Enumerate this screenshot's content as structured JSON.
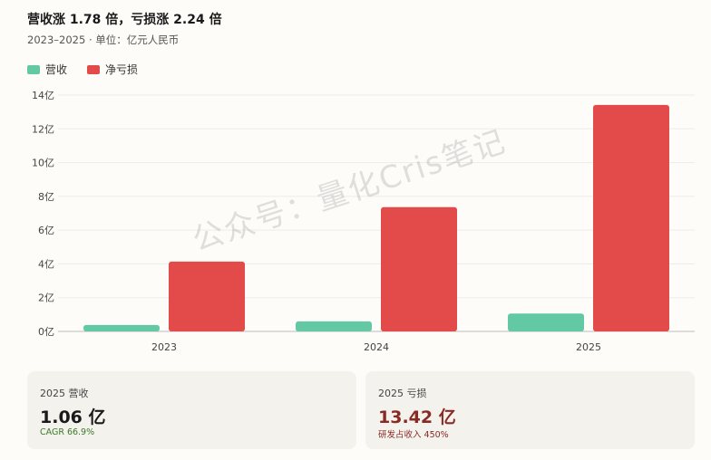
{
  "header": {
    "title": "营收涨 1.78 倍，亏损涨 2.24 倍",
    "subtitle": "2023–2025 · 单位：亿元人民币"
  },
  "legend": [
    {
      "label": "营收",
      "color": "#63c9a4"
    },
    {
      "label": "净亏损",
      "color": "#e24b4a"
    }
  ],
  "chart_data": {
    "type": "bar",
    "categories": [
      "2023",
      "2024",
      "2025"
    ],
    "series": [
      {
        "name": "营收",
        "values": [
          0.38,
          0.6,
          1.06
        ],
        "color": "#63c9a4"
      },
      {
        "name": "净亏损",
        "values": [
          4.14,
          7.36,
          13.42
        ],
        "color": "#e24b4a"
      }
    ],
    "ylim": [
      0,
      14
    ],
    "yticks": [
      0,
      2,
      4,
      6,
      8,
      10,
      12,
      14
    ],
    "ytick_labels": [
      "0亿",
      "2亿",
      "4亿",
      "6亿",
      "8亿",
      "10亿",
      "12亿",
      "14亿"
    ],
    "grid": true,
    "legend_position": "top-left"
  },
  "cards": [
    {
      "label": "2025 营收",
      "value": "1.06 亿",
      "note": "CAGR 66.9%"
    },
    {
      "label": "2025 亏损",
      "value": "13.42 亿",
      "note": "研发占收入 450%"
    }
  ],
  "watermark": "公众号：量化Cris笔记"
}
